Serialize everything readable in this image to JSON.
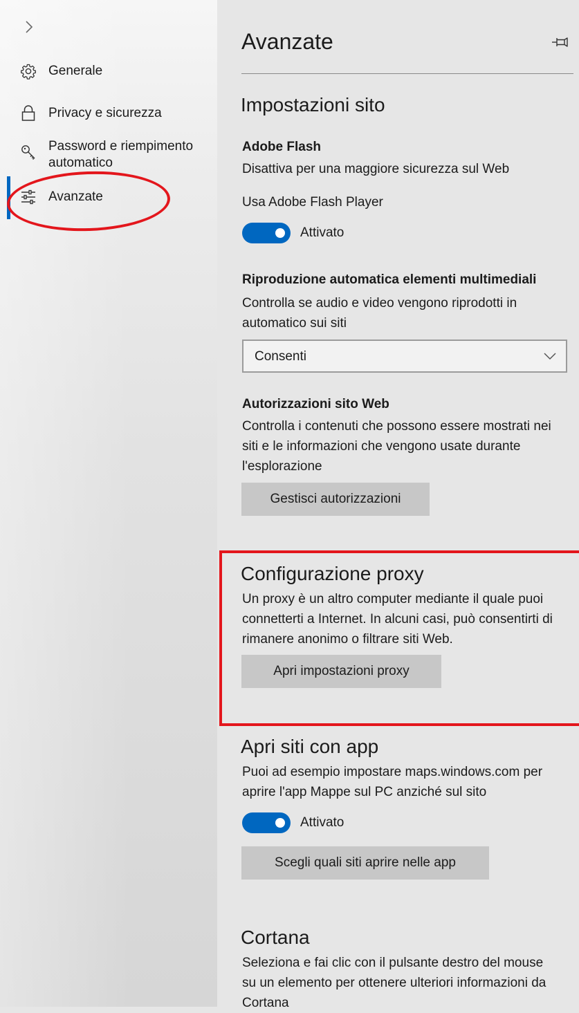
{
  "sidebar": {
    "items": [
      {
        "label": "Generale",
        "icon": "gear-icon"
      },
      {
        "label": "Privacy e sicurezza",
        "icon": "lock-icon"
      },
      {
        "label": "Password e riempimento automatico",
        "icon": "key-icon"
      },
      {
        "label": "Avanzate",
        "icon": "sliders-icon",
        "active": true
      }
    ]
  },
  "main": {
    "title": "Avanzate",
    "site_settings": {
      "heading": "Impostazioni sito",
      "flash": {
        "title": "Adobe Flash",
        "description": "Disattiva per una maggiore sicurezza sul Web",
        "toggle_caption": "Usa Adobe Flash Player",
        "toggle_state": "Attivato"
      },
      "autoplay": {
        "title": "Riproduzione automatica elementi multimediali",
        "description": "Controlla se audio e video vengono riprodotti in automatico sui siti",
        "selected": "Consenti"
      },
      "permissions": {
        "title": "Autorizzazioni sito Web",
        "description": "Controlla i contenuti che possono essere mostrati nei siti e le informazioni che vengono usate durante l'esplorazione",
        "button": "Gestisci autorizzazioni"
      }
    },
    "proxy": {
      "heading": "Configurazione proxy",
      "description": "Un proxy è un altro computer mediante il quale puoi connetterti a Internet. In alcuni casi, può consentirti di rimanere anonimo o filtrare siti Web.",
      "button": "Apri impostazioni proxy"
    },
    "apps": {
      "heading": "Apri siti con app",
      "description": "Puoi ad esempio impostare maps.windows.com per aprire l'app Mappe sul PC anziché sul sito",
      "toggle_state": "Attivato",
      "button": "Scegli quali siti aprire nelle app"
    },
    "cortana": {
      "heading": "Cortana",
      "description": "Seleziona e fai clic con il pulsante destro del mouse su un elemento per ottenere ulteriori informazioni da Cortana"
    }
  },
  "colors": {
    "accent": "#0067c0",
    "annotation": "#e3161c",
    "panel_bg": "#e6e6e6",
    "button_bg": "#c7c7c7"
  }
}
